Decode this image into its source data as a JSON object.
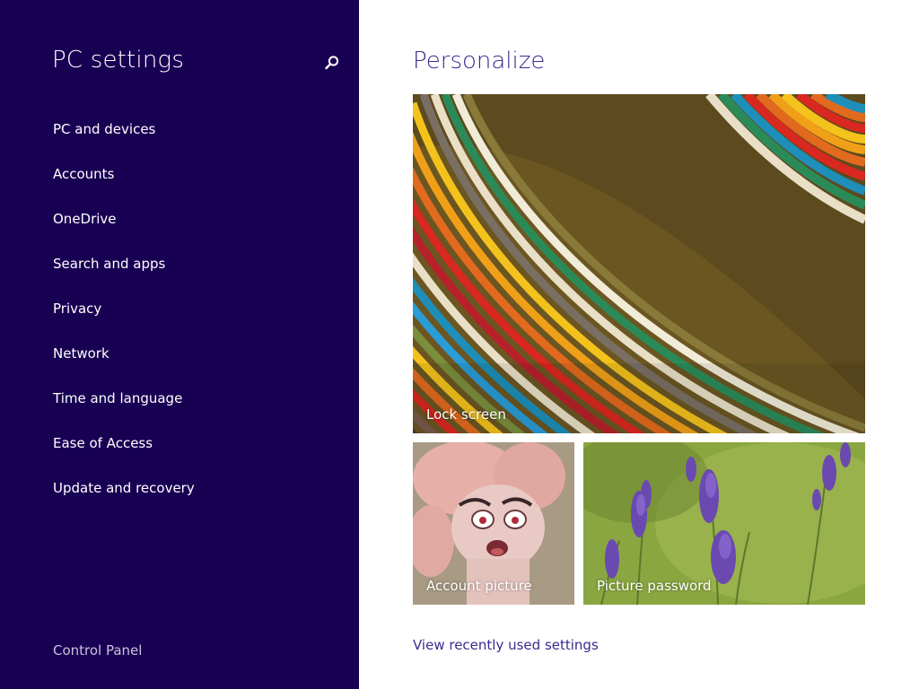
{
  "app": {
    "title": "PC settings",
    "search_icon": "search-icon"
  },
  "nav": {
    "items": [
      {
        "label": "PC and devices"
      },
      {
        "label": "Accounts"
      },
      {
        "label": "OneDrive"
      },
      {
        "label": "Search and apps"
      },
      {
        "label": "Privacy"
      },
      {
        "label": "Network"
      },
      {
        "label": "Time and language"
      },
      {
        "label": "Ease of Access"
      },
      {
        "label": "Update and recovery"
      }
    ],
    "footer": "Control Panel"
  },
  "main": {
    "title": "Personalize",
    "tiles": {
      "lock_screen": "Lock screen",
      "account_picture": "Account picture",
      "picture_password": "Picture password"
    },
    "recent_link": "View recently used settings"
  },
  "colors": {
    "nav_background": "#180053",
    "accent": "#3c2a8e",
    "content_background": "#ffffff"
  }
}
